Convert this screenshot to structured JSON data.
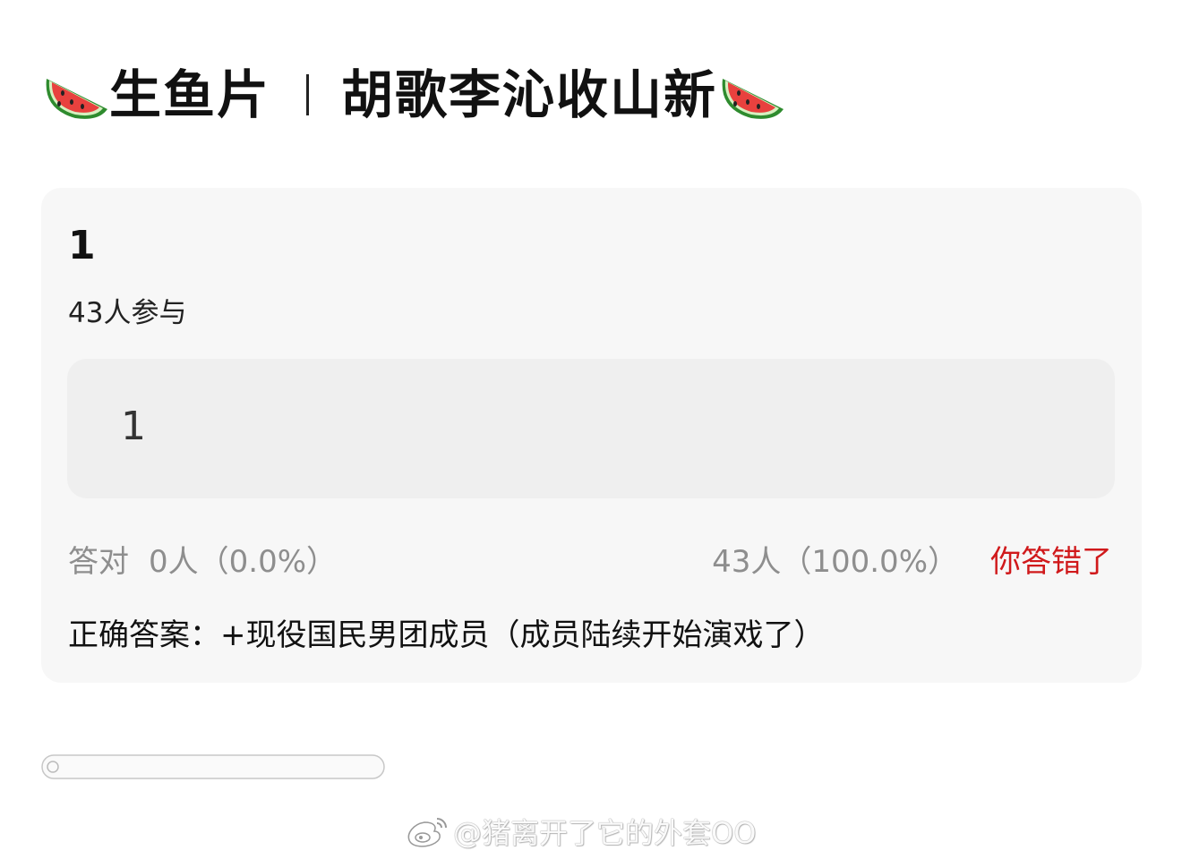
{
  "header": {
    "left_icon": "watermelon-icon",
    "title_left": "生鱼片",
    "title_right": "胡歌李沁收山新",
    "right_icon": "watermelon-icon"
  },
  "quiz": {
    "question": "1",
    "participants": "43人参与",
    "option_label": "1",
    "correct_label": "答对",
    "correct_count": "0人（0.0%）",
    "wrong_count": "43人（100.0%）",
    "wrong_status": "你答错了",
    "answer_text": "正确答案：+现役国民男团成员（成员陆续开始演戏了）"
  },
  "watermark": {
    "icon": "weibo-icon",
    "text": "@猪离开了它的外套OO"
  },
  "colors": {
    "wrong": "#d0191b",
    "card_bg": "#f7f7f7",
    "option_bg": "#efefef",
    "muted_text": "#8e8e8e"
  }
}
